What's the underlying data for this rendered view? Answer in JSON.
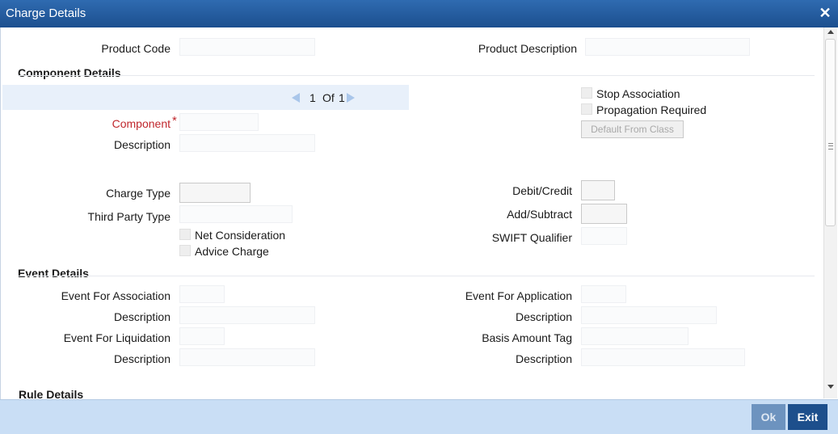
{
  "window": {
    "title": "Charge Details"
  },
  "header": {
    "product_code_label": "Product Code",
    "product_description_label": "Product Description"
  },
  "component_details": {
    "section_title": "Component Details",
    "pager": {
      "current": "1",
      "of_label": "Of",
      "total": "1"
    },
    "component_label": "Component",
    "required_marker": "*",
    "description_label": "Description",
    "stop_association_label": "Stop Association",
    "propagation_required_label": "Propagation Required",
    "default_from_class_label": "Default From Class",
    "charge_type_label": "Charge Type",
    "third_party_type_label": "Third Party Type",
    "net_consideration_label": "Net Consideration",
    "advice_charge_label": "Advice Charge",
    "debit_credit_label": "Debit/Credit",
    "add_subtract_label": "Add/Subtract",
    "swift_qualifier_label": "SWIFT Qualifier"
  },
  "event_details": {
    "section_title": "Event Details",
    "event_for_association_label": "Event For Association",
    "description1_label": "Description",
    "event_for_liquidation_label": "Event For Liquidation",
    "description2_label": "Description",
    "event_for_application_label": "Event For Application",
    "description3_label": "Description",
    "basis_amount_tag_label": "Basis Amount Tag",
    "description4_label": "Description"
  },
  "next_section_title": "Rule Details",
  "footer": {
    "ok_label": "Ok",
    "exit_label": "Exit"
  },
  "colors": {
    "titlebar": "#1c4f8f",
    "footer": "#c9def5",
    "exit_button": "#1d4f8c",
    "ok_button_disabled": "#6d93bf",
    "required": "#c0272d"
  }
}
